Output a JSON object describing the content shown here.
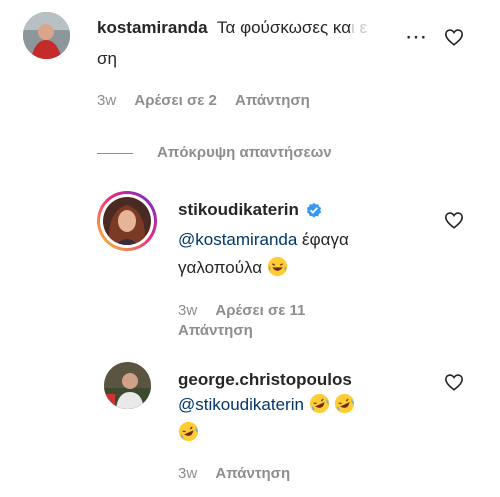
{
  "comments": [
    {
      "username": "kostamiranda",
      "text_line1": "Τα φούσκωσες κα",
      "text_faded": "ι ε",
      "text_line2": "ση",
      "time": "3w",
      "likes": "Αρέσει σε 2",
      "reply": "Απάντηση"
    }
  ],
  "hide_replies": "Απόκρυψη απαντήσεων",
  "replies": [
    {
      "username": "stikoudikaterin",
      "verified": true,
      "mention": "@kostamiranda",
      "text_rest": " έφαγα",
      "text_line2": "γαλοπούλα",
      "time": "3w",
      "likes": "Αρέσει σε 11",
      "reply": "Απάντηση"
    },
    {
      "username": "george.christopoulos",
      "mention": "@stikoudikaterin",
      "time": "3w",
      "reply": "Απάντηση"
    }
  ],
  "more_icon": "⋯",
  "colors": {
    "mention": "#00376b",
    "meta": "#8e8e8e",
    "verified": "#3897f0",
    "emoji": "#ffcc33"
  }
}
